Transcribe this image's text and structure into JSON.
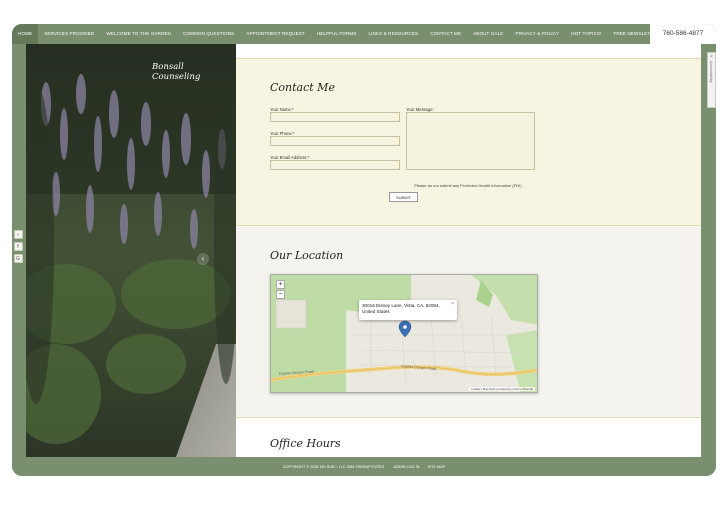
{
  "nav": {
    "items": [
      {
        "label": "HOME"
      },
      {
        "label": "SERVICES PROVIDED"
      },
      {
        "label": "WELCOME TO THE GARDEN"
      },
      {
        "label": "COMMON QUESTIONS"
      },
      {
        "label": "APPOINTMENT REQUEST"
      },
      {
        "label": "HELPFUL FORMS"
      },
      {
        "label": "LINKS & RESOURCES"
      },
      {
        "label": "CONTACT ME"
      },
      {
        "label": "ABOUT GALE"
      },
      {
        "label": "PRIVACY & POLICY"
      },
      {
        "label": "HOT TOPICS!"
      },
      {
        "label": "FREE NEWSLETTERS"
      }
    ],
    "phone": "760-586-4877"
  },
  "side_icons": [
    {
      "icon": "user-icon",
      "glyph": "♀"
    },
    {
      "icon": "facebook-icon",
      "glyph": "f"
    },
    {
      "icon": "google-icon",
      "glyph": "G"
    }
  ],
  "right_tab": {
    "close": "×",
    "label": "Accessibility"
  },
  "hero": {
    "brand_line1": "Bonsall",
    "brand_line2": "Counseling",
    "arrow": "‹"
  },
  "contact": {
    "title": "Contact Me",
    "name_label": "Your Name:*",
    "phone_label": "Your Phone:*",
    "email_label": "Your Email Address:*",
    "message_label": "Your Message:",
    "note": "Please do not submit any Protected Health Information (PHI).",
    "submit": "SUBMIT"
  },
  "location": {
    "title": "Our Location",
    "zoom_in": "+",
    "zoom_out": "−",
    "popup_text": "30016 Disney Lane, Vista, CA, 92084, United States",
    "popup_close": "×",
    "attribution": "Leaflet | Map data provided by Internet Brands",
    "road_label_1": "Gopher Canyon Road",
    "road_label_2": "Gopher Canyon Road"
  },
  "office": {
    "title": "Office Hours"
  },
  "footer": {
    "copyright": "COPYRIGHT © 2026 MH SUB I, LLC DBA THERAPYSITES.",
    "admin": "ADMIN LOG IN",
    "sitemap": "SITE MAP"
  },
  "colors": {
    "nav_bg": "#7a8f6d",
    "contact_bg": "#f7f5e1",
    "location_bg": "#f5f3ee",
    "accent_line": "#e3dcb3",
    "map_marker": "#3b6fb6"
  }
}
